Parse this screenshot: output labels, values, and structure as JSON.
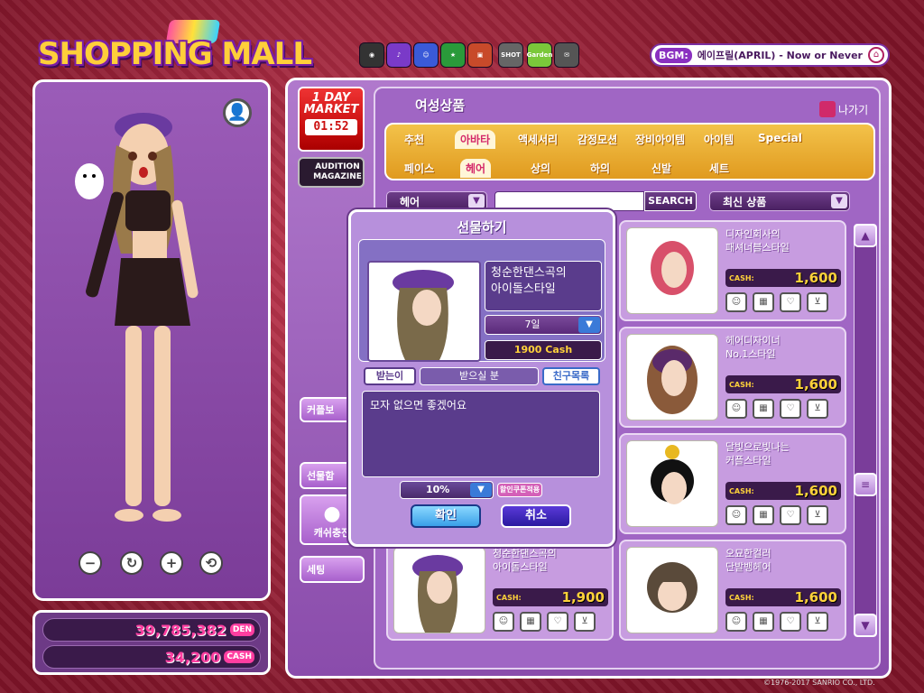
{
  "header": {
    "logo_text": "SHOPPING MALL",
    "top_icons": [
      "cd-icon",
      "music-note-icon",
      "avatar-icon",
      "star-icon",
      "tv-icon",
      "shot-icon",
      "garden-icon",
      "chat-icon"
    ],
    "top_icon_labels": {
      "shot": "SHOT",
      "garden": "Garden"
    },
    "bgm": {
      "label": "BGM:",
      "song": "에이프릴(APRIL) - Now or Never"
    }
  },
  "money": {
    "den_value": "39,785,382",
    "den_unit": "DEN",
    "cash_value": "34,200",
    "cash_unit": "CASH"
  },
  "side": {
    "oneday_title": "1 DAY MARKET",
    "oneday_timer": "01:52",
    "magazine": "AUDITION MAGAZINE",
    "couple_btn": "커플보",
    "gift_btn": "선물함",
    "cash_charge_btn": "캐쉬충전",
    "setting_btn": "세팅"
  },
  "store": {
    "title": "여성상품",
    "exit_label": "나가기",
    "tabs_row1": [
      "추천",
      "아바타",
      "액세서리",
      "감정모션",
      "장비아이템",
      "아이템",
      "Special"
    ],
    "tabs_row2": [
      "페이스",
      "헤어",
      "상의",
      "하의",
      "신발",
      "세트"
    ],
    "active_tab1": "아바타",
    "active_tab2": "헤어",
    "category_filter": "헤어",
    "search_label": "SEARCH",
    "sort_filter": "최신 상품"
  },
  "products": [
    {
      "name": "디자인회사의\n패셔너블스타일",
      "price": "1,600",
      "unit": "CASH:"
    },
    {
      "name": "헤어디자이너\nNo.1스타일",
      "price": "1,600",
      "unit": "CASH:"
    },
    {
      "name": "달빛으로빛나는\n커플스타일",
      "price": "1,600",
      "unit": "CASH:"
    },
    {
      "name": "청순한댄스곡의\n아이돌스타일",
      "price": "1,900",
      "unit": "CASH:"
    },
    {
      "name": "오묘한컬러\n단발뱅헤어",
      "price": "1,600",
      "unit": "CASH:"
    }
  ],
  "gift_dialog": {
    "title": "선물하기",
    "item_name": "청순한댄스곡의\n아이돌스타일",
    "period": "7일",
    "price": "1900 Cash",
    "recipient_label": "받는이",
    "recipient_placeholder": "받으실 분",
    "friends_btn": "친구목록",
    "message": "모자 없으면 좋겠어요",
    "discount": "10%",
    "coupon_btn": "할인쿠폰적용",
    "ok_btn": "확인",
    "cancel_btn": "취소"
  },
  "copyright": "©1976-2017 SANRIO CO., LTD."
}
